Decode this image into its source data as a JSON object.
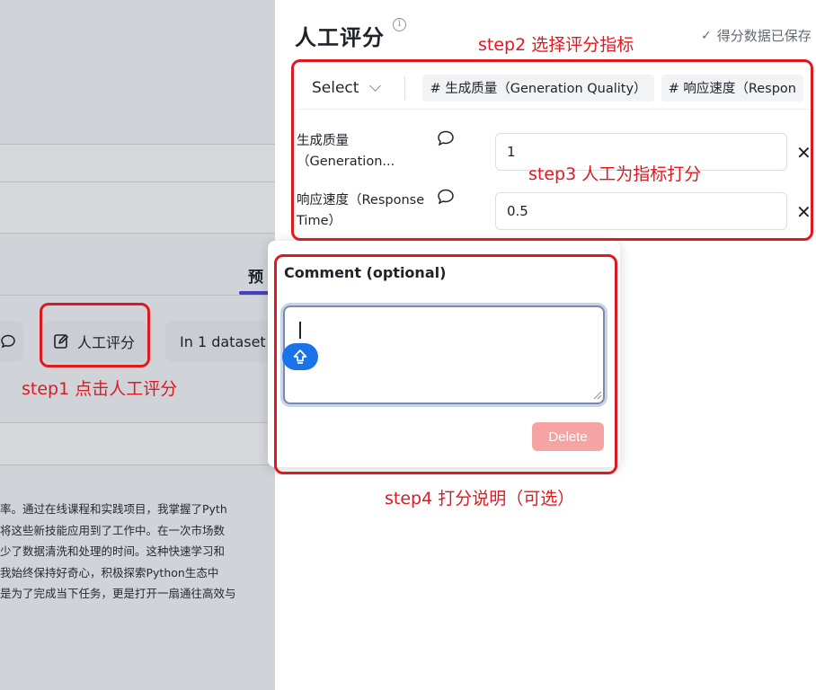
{
  "background_app": {
    "tab_label": "预",
    "actions": {
      "manual_score_label": "人工评分",
      "dataset_label": "In 1 dataset"
    },
    "body_lines": [
      "率。通过在线课程和实践项目，我掌握了Pyth",
      "将这些新技能应用到了工作中。在一次市场数",
      "少了数据清洗和处理的时间。这种快速学习和",
      "我始终保持好奇心，积极探索Python生态中",
      "是为了完成当下任务，更是打开一扇通往高效与"
    ]
  },
  "panel": {
    "title": "人工评分",
    "save_status": "得分数据已保存",
    "select": {
      "label": "Select",
      "tags": [
        "# 生成质量（Generation Quality）",
        "# 响应速度（Respon"
      ]
    },
    "metrics": [
      {
        "label_line1": "生成质量",
        "label_line2": "（Generation...",
        "value": "1"
      },
      {
        "label_line1": "响应速度（Response",
        "label_line2": "Time）",
        "value": "0.5"
      }
    ]
  },
  "comment_popover": {
    "title": "Comment (optional)",
    "value": "",
    "delete_label": "Delete"
  },
  "annotations": {
    "step1": "step1 点击人工评分",
    "step2": "step2 选择评分指标",
    "step3": "step3 人工为指标打分",
    "step4": "step4 打分说明（可选）"
  },
  "colors": {
    "annotation_red": "#e0181f",
    "accent_blue": "#1a73e8",
    "tab_indicator": "#4e47d6",
    "delete_disabled": "#f5a3a3"
  }
}
